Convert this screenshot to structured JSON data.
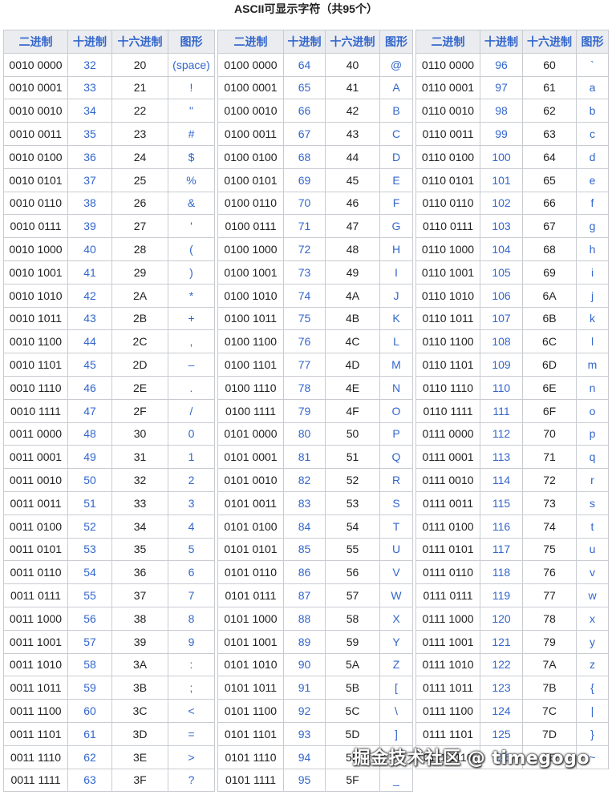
{
  "title": "ASCII可显示字符（共95个）",
  "headers": [
    "二进制",
    "十进制",
    "十六进制",
    "图形"
  ],
  "watermark": "掘金技术社区 @ timegogo",
  "colors": {
    "header_bg": "#eaecf0",
    "header_text": "#3366cc",
    "link": "#3366cc",
    "border": "#c8ccd1"
  },
  "columns": [
    {
      "rows": [
        {
          "bin": "0010 0000",
          "dec": "32",
          "hex": "20",
          "glyph": "(space)"
        },
        {
          "bin": "0010 0001",
          "dec": "33",
          "hex": "21",
          "glyph": "!"
        },
        {
          "bin": "0010 0010",
          "dec": "34",
          "hex": "22",
          "glyph": "\""
        },
        {
          "bin": "0010 0011",
          "dec": "35",
          "hex": "23",
          "glyph": "#"
        },
        {
          "bin": "0010 0100",
          "dec": "36",
          "hex": "24",
          "glyph": "$"
        },
        {
          "bin": "0010 0101",
          "dec": "37",
          "hex": "25",
          "glyph": "%"
        },
        {
          "bin": "0010 0110",
          "dec": "38",
          "hex": "26",
          "glyph": "&"
        },
        {
          "bin": "0010 0111",
          "dec": "39",
          "hex": "27",
          "glyph": "'"
        },
        {
          "bin": "0010 1000",
          "dec": "40",
          "hex": "28",
          "glyph": "("
        },
        {
          "bin": "0010 1001",
          "dec": "41",
          "hex": "29",
          "glyph": ")"
        },
        {
          "bin": "0010 1010",
          "dec": "42",
          "hex": "2A",
          "glyph": "*"
        },
        {
          "bin": "0010 1011",
          "dec": "43",
          "hex": "2B",
          "glyph": "+"
        },
        {
          "bin": "0010 1100",
          "dec": "44",
          "hex": "2C",
          "glyph": ","
        },
        {
          "bin": "0010 1101",
          "dec": "45",
          "hex": "2D",
          "glyph": "–"
        },
        {
          "bin": "0010 1110",
          "dec": "46",
          "hex": "2E",
          "glyph": "."
        },
        {
          "bin": "0010 1111",
          "dec": "47",
          "hex": "2F",
          "glyph": "/"
        },
        {
          "bin": "0011 0000",
          "dec": "48",
          "hex": "30",
          "glyph": "0"
        },
        {
          "bin": "0011 0001",
          "dec": "49",
          "hex": "31",
          "glyph": "1"
        },
        {
          "bin": "0011 0010",
          "dec": "50",
          "hex": "32",
          "glyph": "2"
        },
        {
          "bin": "0011 0011",
          "dec": "51",
          "hex": "33",
          "glyph": "3"
        },
        {
          "bin": "0011 0100",
          "dec": "52",
          "hex": "34",
          "glyph": "4"
        },
        {
          "bin": "0011 0101",
          "dec": "53",
          "hex": "35",
          "glyph": "5"
        },
        {
          "bin": "0011 0110",
          "dec": "54",
          "hex": "36",
          "glyph": "6"
        },
        {
          "bin": "0011 0111",
          "dec": "55",
          "hex": "37",
          "glyph": "7"
        },
        {
          "bin": "0011 1000",
          "dec": "56",
          "hex": "38",
          "glyph": "8"
        },
        {
          "bin": "0011 1001",
          "dec": "57",
          "hex": "39",
          "glyph": "9"
        },
        {
          "bin": "0011 1010",
          "dec": "58",
          "hex": "3A",
          "glyph": ":"
        },
        {
          "bin": "0011 1011",
          "dec": "59",
          "hex": "3B",
          "glyph": ";"
        },
        {
          "bin": "0011 1100",
          "dec": "60",
          "hex": "3C",
          "glyph": "<"
        },
        {
          "bin": "0011 1101",
          "dec": "61",
          "hex": "3D",
          "glyph": "="
        },
        {
          "bin": "0011 1110",
          "dec": "62",
          "hex": "3E",
          "glyph": ">"
        },
        {
          "bin": "0011 1111",
          "dec": "63",
          "hex": "3F",
          "glyph": "?"
        }
      ]
    },
    {
      "rows": [
        {
          "bin": "0100 0000",
          "dec": "64",
          "hex": "40",
          "glyph": "@"
        },
        {
          "bin": "0100 0001",
          "dec": "65",
          "hex": "41",
          "glyph": "A"
        },
        {
          "bin": "0100 0010",
          "dec": "66",
          "hex": "42",
          "glyph": "B"
        },
        {
          "bin": "0100 0011",
          "dec": "67",
          "hex": "43",
          "glyph": "C"
        },
        {
          "bin": "0100 0100",
          "dec": "68",
          "hex": "44",
          "glyph": "D"
        },
        {
          "bin": "0100 0101",
          "dec": "69",
          "hex": "45",
          "glyph": "E"
        },
        {
          "bin": "0100 0110",
          "dec": "70",
          "hex": "46",
          "glyph": "F"
        },
        {
          "bin": "0100 0111",
          "dec": "71",
          "hex": "47",
          "glyph": "G"
        },
        {
          "bin": "0100 1000",
          "dec": "72",
          "hex": "48",
          "glyph": "H"
        },
        {
          "bin": "0100 1001",
          "dec": "73",
          "hex": "49",
          "glyph": "I"
        },
        {
          "bin": "0100 1010",
          "dec": "74",
          "hex": "4A",
          "glyph": "J"
        },
        {
          "bin": "0100 1011",
          "dec": "75",
          "hex": "4B",
          "glyph": "K"
        },
        {
          "bin": "0100 1100",
          "dec": "76",
          "hex": "4C",
          "glyph": "L"
        },
        {
          "bin": "0100 1101",
          "dec": "77",
          "hex": "4D",
          "glyph": "M"
        },
        {
          "bin": "0100 1110",
          "dec": "78",
          "hex": "4E",
          "glyph": "N"
        },
        {
          "bin": "0100 1111",
          "dec": "79",
          "hex": "4F",
          "glyph": "O"
        },
        {
          "bin": "0101 0000",
          "dec": "80",
          "hex": "50",
          "glyph": "P"
        },
        {
          "bin": "0101 0001",
          "dec": "81",
          "hex": "51",
          "glyph": "Q"
        },
        {
          "bin": "0101 0010",
          "dec": "82",
          "hex": "52",
          "glyph": "R"
        },
        {
          "bin": "0101 0011",
          "dec": "83",
          "hex": "53",
          "glyph": "S"
        },
        {
          "bin": "0101 0100",
          "dec": "84",
          "hex": "54",
          "glyph": "T"
        },
        {
          "bin": "0101 0101",
          "dec": "85",
          "hex": "55",
          "glyph": "U"
        },
        {
          "bin": "0101 0110",
          "dec": "86",
          "hex": "56",
          "glyph": "V"
        },
        {
          "bin": "0101 0111",
          "dec": "87",
          "hex": "57",
          "glyph": "W"
        },
        {
          "bin": "0101 1000",
          "dec": "88",
          "hex": "58",
          "glyph": "X"
        },
        {
          "bin": "0101 1001",
          "dec": "89",
          "hex": "59",
          "glyph": "Y"
        },
        {
          "bin": "0101 1010",
          "dec": "90",
          "hex": "5A",
          "glyph": "Z"
        },
        {
          "bin": "0101 1011",
          "dec": "91",
          "hex": "5B",
          "glyph": "["
        },
        {
          "bin": "0101 1100",
          "dec": "92",
          "hex": "5C",
          "glyph": "\\"
        },
        {
          "bin": "0101 1101",
          "dec": "93",
          "hex": "5D",
          "glyph": "]"
        },
        {
          "bin": "0101 1110",
          "dec": "94",
          "hex": "5E",
          "glyph": "^"
        },
        {
          "bin": "0101 1111",
          "dec": "95",
          "hex": "5F",
          "glyph": "_"
        }
      ]
    },
    {
      "rows": [
        {
          "bin": "0110 0000",
          "dec": "96",
          "hex": "60",
          "glyph": "`"
        },
        {
          "bin": "0110 0001",
          "dec": "97",
          "hex": "61",
          "glyph": "a"
        },
        {
          "bin": "0110 0010",
          "dec": "98",
          "hex": "62",
          "glyph": "b"
        },
        {
          "bin": "0110 0011",
          "dec": "99",
          "hex": "63",
          "glyph": "c"
        },
        {
          "bin": "0110 0100",
          "dec": "100",
          "hex": "64",
          "glyph": "d"
        },
        {
          "bin": "0110 0101",
          "dec": "101",
          "hex": "65",
          "glyph": "e"
        },
        {
          "bin": "0110 0110",
          "dec": "102",
          "hex": "66",
          "glyph": "f"
        },
        {
          "bin": "0110 0111",
          "dec": "103",
          "hex": "67",
          "glyph": "g"
        },
        {
          "bin": "0110 1000",
          "dec": "104",
          "hex": "68",
          "glyph": "h"
        },
        {
          "bin": "0110 1001",
          "dec": "105",
          "hex": "69",
          "glyph": "i"
        },
        {
          "bin": "0110 1010",
          "dec": "106",
          "hex": "6A",
          "glyph": "j"
        },
        {
          "bin": "0110 1011",
          "dec": "107",
          "hex": "6B",
          "glyph": "k"
        },
        {
          "bin": "0110 1100",
          "dec": "108",
          "hex": "6C",
          "glyph": "l"
        },
        {
          "bin": "0110 1101",
          "dec": "109",
          "hex": "6D",
          "glyph": "m"
        },
        {
          "bin": "0110 1110",
          "dec": "110",
          "hex": "6E",
          "glyph": "n"
        },
        {
          "bin": "0110 1111",
          "dec": "111",
          "hex": "6F",
          "glyph": "o"
        },
        {
          "bin": "0111 0000",
          "dec": "112",
          "hex": "70",
          "glyph": "p"
        },
        {
          "bin": "0111 0001",
          "dec": "113",
          "hex": "71",
          "glyph": "q"
        },
        {
          "bin": "0111 0010",
          "dec": "114",
          "hex": "72",
          "glyph": "r"
        },
        {
          "bin": "0111 0011",
          "dec": "115",
          "hex": "73",
          "glyph": "s"
        },
        {
          "bin": "0111 0100",
          "dec": "116",
          "hex": "74",
          "glyph": "t"
        },
        {
          "bin": "0111 0101",
          "dec": "117",
          "hex": "75",
          "glyph": "u"
        },
        {
          "bin": "0111 0110",
          "dec": "118",
          "hex": "76",
          "glyph": "v"
        },
        {
          "bin": "0111 0111",
          "dec": "119",
          "hex": "77",
          "glyph": "w"
        },
        {
          "bin": "0111 1000",
          "dec": "120",
          "hex": "78",
          "glyph": "x"
        },
        {
          "bin": "0111 1001",
          "dec": "121",
          "hex": "79",
          "glyph": "y"
        },
        {
          "bin": "0111 1010",
          "dec": "122",
          "hex": "7A",
          "glyph": "z"
        },
        {
          "bin": "0111 1011",
          "dec": "123",
          "hex": "7B",
          "glyph": "{"
        },
        {
          "bin": "0111 1100",
          "dec": "124",
          "hex": "7C",
          "glyph": "|"
        },
        {
          "bin": "0111 1101",
          "dec": "125",
          "hex": "7D",
          "glyph": "}"
        },
        {
          "bin": "0111 1110",
          "dec": "126",
          "hex": "7E",
          "glyph": "~"
        }
      ]
    }
  ]
}
